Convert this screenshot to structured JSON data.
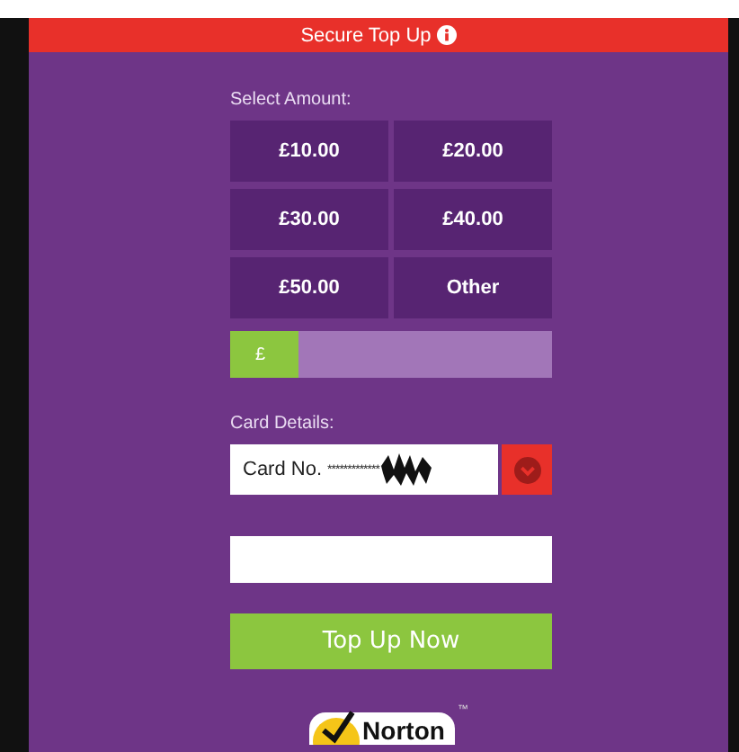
{
  "header": {
    "title": "Secure Top Up"
  },
  "amount_label": "Select Amount:",
  "amounts": [
    {
      "label": "£10.00",
      "selected": false
    },
    {
      "label": "£20.00",
      "selected": false
    },
    {
      "label": "£30.00",
      "selected": false
    },
    {
      "label": "£40.00",
      "selected": false
    },
    {
      "label": "£50.00",
      "selected": false
    },
    {
      "label": "Other",
      "selected": false
    }
  ],
  "custom_amount": {
    "prefix": "£"
  },
  "card_label": "Card Details:",
  "card_field": {
    "label": "Card No.",
    "value": "*************"
  },
  "submit": "Top Up Now",
  "badge": {
    "text": "Norton",
    "mark": "™"
  }
}
